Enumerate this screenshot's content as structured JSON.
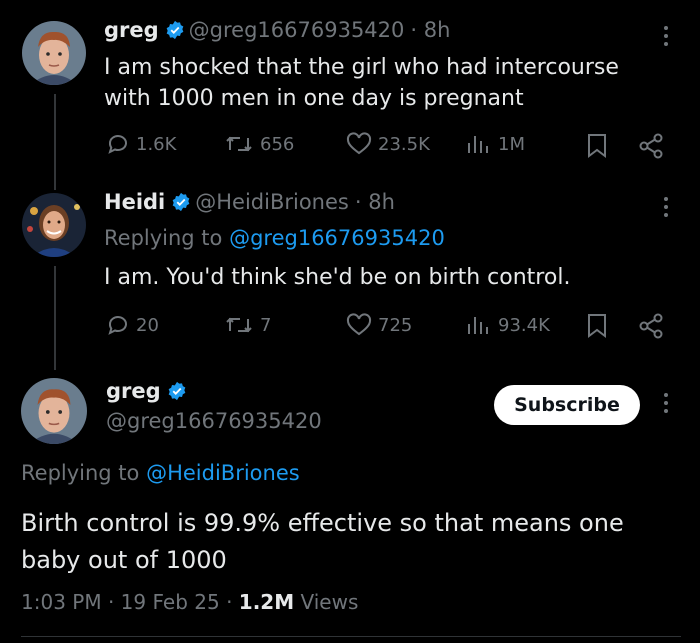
{
  "tweet1": {
    "name": "greg",
    "handle": "@greg16676935420",
    "time": "· 8h",
    "text": "I am shocked that the girl who had intercourse with 1000 men in one day is pregnant",
    "replies": "1.6K",
    "retweets": "656",
    "likes": "23.5K",
    "views": "1M"
  },
  "tweet2": {
    "name": "Heidi",
    "handle": "@HeidiBriones",
    "time": "· 8h",
    "replying_prefix": "Replying to ",
    "replying_to": "@greg16676935420",
    "text": "I am. You'd think she'd be on birth control.",
    "replies": "20",
    "retweets": "7",
    "likes": "725",
    "views": "93.4K"
  },
  "main": {
    "name": "greg",
    "handle": "@greg16676935420",
    "subscribe_label": "Subscribe",
    "replying_prefix": "Replying to ",
    "replying_to": "@HeidiBriones",
    "text": "Birth control is 99.9% effective so that means one baby out of 1000",
    "time": "1:03 PM",
    "date": "19 Feb 25",
    "views_count": "1.2M",
    "views_label": "Views"
  },
  "colors": {
    "background": "#000000",
    "text": "#e7e9ea",
    "muted": "#71767b",
    "link": "#1d9bf0",
    "verified": "#1d9bf0"
  },
  "icons": [
    "verified-badge-icon",
    "reply-icon",
    "retweet-icon",
    "like-icon",
    "views-icon",
    "bookmark-icon",
    "share-icon",
    "more-icon"
  ]
}
